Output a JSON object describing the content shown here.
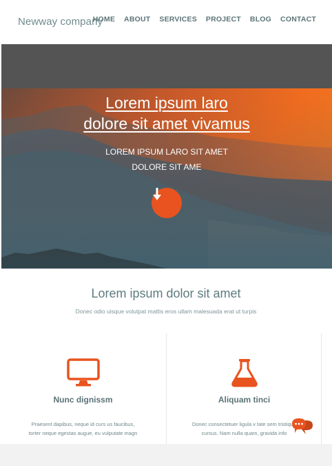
{
  "header": {
    "logo": "Newway company",
    "nav": [
      "HOME",
      "ABOUT",
      "SERVICES",
      "PROJECT",
      "BLOG",
      "CONTACT"
    ]
  },
  "hero": {
    "title_line1": "Lorem ipsum laro",
    "title_line2": "dolore sit amet vivamus",
    "subtitle_line1": "LOREM IPSUM LARO SIT AMET",
    "subtitle_line2": "DOLORE SIT AME",
    "scroll_icon": "arrow-down-icon"
  },
  "section": {
    "title": "Lorem ipsum dolor sit amet",
    "subtitle": "Donec odio uisque volutpat mattis eros ullam malesuada erat ut turpis"
  },
  "features": [
    {
      "icon": "monitor-icon",
      "title": "Nunc dignissm",
      "text_line1": "Praesent dapibus, neque id curs us faucibus,",
      "text_line2": "torter neque egestas augue, eu vulputate magn"
    },
    {
      "icon": "flask-icon",
      "title": "Aliquam tinci",
      "text_line1": "Donec consectetuer ligula v tate sem tristique",
      "text_line2": "cursus. Nam nulla quam, gravida info"
    }
  ],
  "chat": {
    "icon": "chat-bubbles-icon"
  },
  "colors": {
    "accent": "#e8531f",
    "text_teal": "#5e7b7f",
    "gray_band": "#545454"
  }
}
